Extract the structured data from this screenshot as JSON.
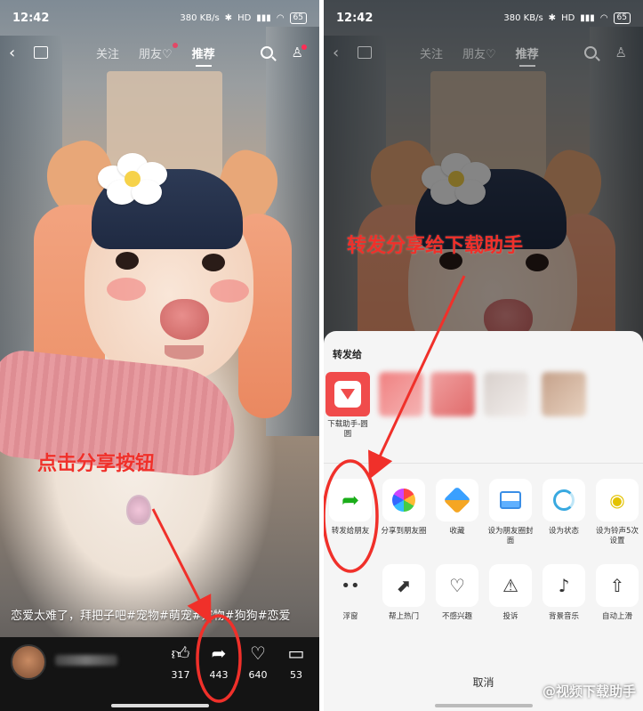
{
  "status_bar": {
    "time": "12:42",
    "network_speed": "380 KB/s",
    "bluetooth": "bluetooth-icon",
    "signal": "HD",
    "battery": "65"
  },
  "nav": {
    "tabs": [
      {
        "label": "关注"
      },
      {
        "label": "朋友♡"
      },
      {
        "label": "推荐"
      }
    ]
  },
  "left": {
    "caption": "恋爱太难了，拜把子吧#宠物#萌宠#宠物#狗狗#恋爱",
    "actions": {
      "like_count": "317",
      "share_count": "443",
      "favorite_count": "640",
      "comment_count": "53"
    },
    "annotation": "点击分享按钮"
  },
  "right": {
    "annotation": "转发分享给下载助手",
    "share_sheet": {
      "title": "转发给",
      "contacts": [
        {
          "label": "下载助手-圆圆"
        }
      ],
      "row1": [
        {
          "label": "转发给朋友",
          "icon": "forward-arrow-icon"
        },
        {
          "label": "分享到朋友圈",
          "icon": "moments-icon"
        },
        {
          "label": "收藏",
          "icon": "cube-icon"
        },
        {
          "label": "设为朋友圈封面",
          "icon": "image-icon"
        },
        {
          "label": "设为状态",
          "icon": "status-ring-icon"
        },
        {
          "label": "设为铃声5次设置",
          "icon": "ringtone-icon"
        }
      ],
      "row2": [
        {
          "label": "浮窗",
          "icon": "float-window-icon"
        },
        {
          "label": "帮上热门",
          "icon": "trending-icon"
        },
        {
          "label": "不感兴趣",
          "icon": "broken-heart-icon"
        },
        {
          "label": "投诉",
          "icon": "warning-icon"
        },
        {
          "label": "背景音乐",
          "icon": "music-icon"
        },
        {
          "label": "自动上滑",
          "icon": "auto-scroll-icon"
        }
      ],
      "cancel_label": "取消"
    },
    "watermark": "@视频下载助手"
  },
  "colors": {
    "annotation_red": "#f0302a",
    "share_green": "#1aad19",
    "sheet_bg": "#f5f5f5",
    "bottom_bar_bg": "#141414"
  }
}
